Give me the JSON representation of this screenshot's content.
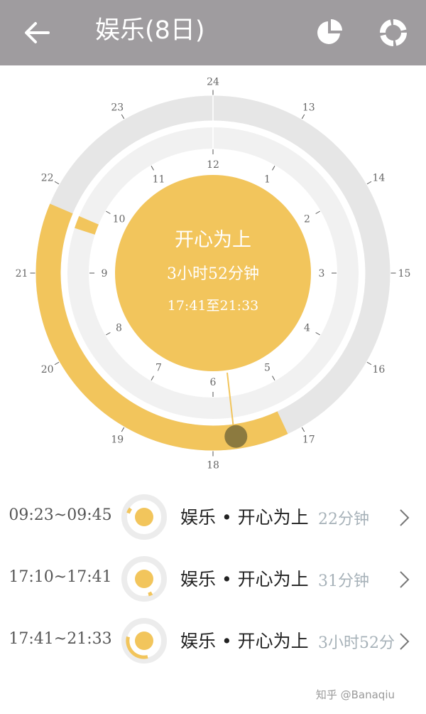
{
  "header": {
    "title": "娱乐(8日)",
    "back_icon": "arrow-left-icon",
    "pie_icon": "pie-chart-icon",
    "ring_icon": "ring-chart-icon",
    "background": "#9f9c9f"
  },
  "clock": {
    "outer_labels": [
      "13",
      "14",
      "15",
      "16",
      "17",
      "18",
      "19",
      "20",
      "21",
      "22",
      "23",
      "24"
    ],
    "inner_labels": [
      "1",
      "2",
      "3",
      "4",
      "5",
      "6",
      "7",
      "8",
      "9",
      "10",
      "11",
      "12"
    ],
    "activity_color": "#f2c55c",
    "track_outer_color": "#e6e6e6",
    "track_inner_color": "#f1f1f1",
    "marker_color": "#8c7a3f",
    "center": {
      "name": "开心为上",
      "duration": "3小时52分钟",
      "range": "17:41至21:33"
    }
  },
  "sessions": [
    {
      "time": "09:23~09:45",
      "label": "娱乐 • 开心为上",
      "duration": "22分钟"
    },
    {
      "time": "17:10~17:41",
      "label": "娱乐 • 开心为上",
      "duration": "31分钟"
    },
    {
      "time": "17:41~21:33",
      "label": "娱乐 • 开心为上",
      "duration": "3小时52分"
    }
  ],
  "watermark": "知乎 @Banaqiu"
}
